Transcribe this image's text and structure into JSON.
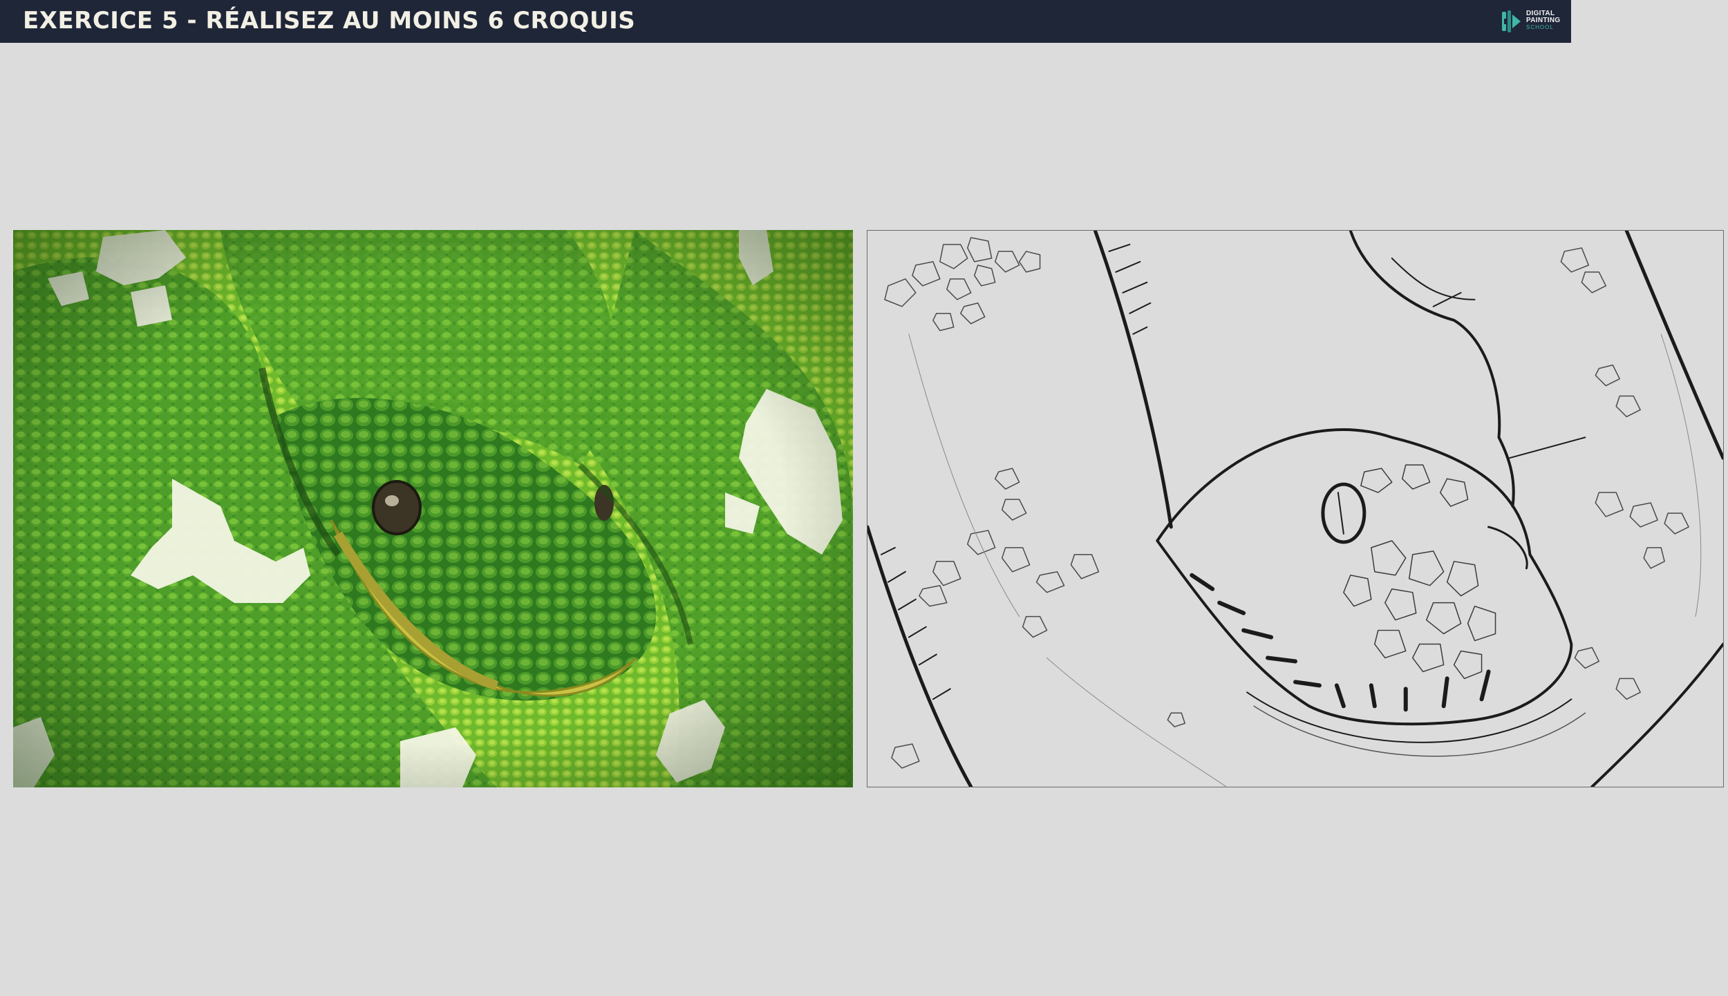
{
  "header": {
    "title": "EXERCICE 5 - RÉALISEZ AU MOINS 6 CROQUIS",
    "background": "#1f2638",
    "title_color": "#f2efe4"
  },
  "logo": {
    "line1": "DIGITAL",
    "line2": "PAINTING",
    "line3": "SCHOOL",
    "accent": "#3fb6a8"
  },
  "canvas_background": "#dcdcdc",
  "reference_photo": {
    "subject": "green tree python coiled, head resting on body",
    "colors": [
      "#3d8a22",
      "#6fb92c",
      "#a7d635",
      "#c9c243",
      "#f3f5e4"
    ]
  },
  "sketch": {
    "subject": "line drawing of the python head",
    "stroke_color": "#1b1b1b"
  }
}
